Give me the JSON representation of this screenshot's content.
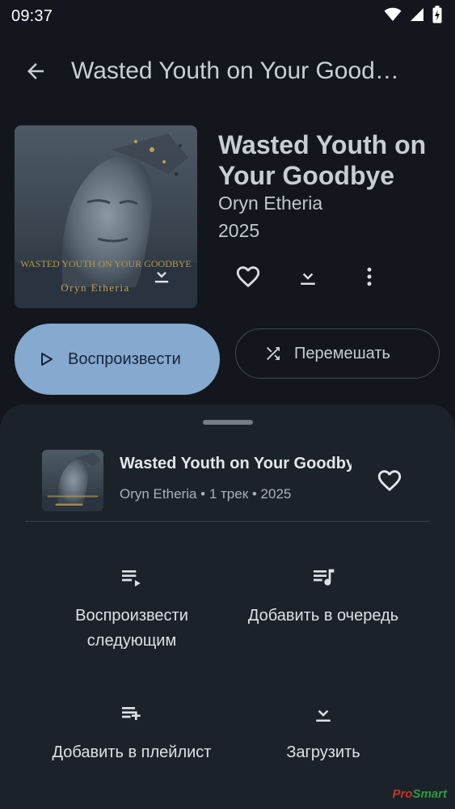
{
  "status_bar": {
    "time": "09:37"
  },
  "header": {
    "title": "Wasted Youth on Your Good…"
  },
  "album": {
    "title": "Wasted Youth on Your Goodbye",
    "artist": "Oryn Etheria",
    "year": "2025",
    "cover_text_top": "WASTED YOUTH ON YOUR GOODBYE",
    "cover_text_bottom": "Oryn Etheria"
  },
  "buttons": {
    "play": "Воспроизвести",
    "shuffle": "Перемешать"
  },
  "sheet": {
    "title": "Wasted Youth on Your Goodbye",
    "meta": "Oryn Etheria • 1 трек • 2025",
    "actions": [
      {
        "label": "Воспроизвести следующим",
        "icon": "play-next-icon"
      },
      {
        "label": "Добавить в очередь",
        "icon": "queue-music-icon"
      },
      {
        "label": "Добавить в плейлист",
        "icon": "playlist-add-icon"
      },
      {
        "label": "Загрузить",
        "icon": "download-icon"
      }
    ]
  },
  "watermark": {
    "part1": "Pro",
    "part2": "Smart"
  },
  "colors": {
    "background": "#13171d",
    "sheet": "#1c222a",
    "accent": "#86a9cf",
    "on_accent": "#16243a"
  }
}
